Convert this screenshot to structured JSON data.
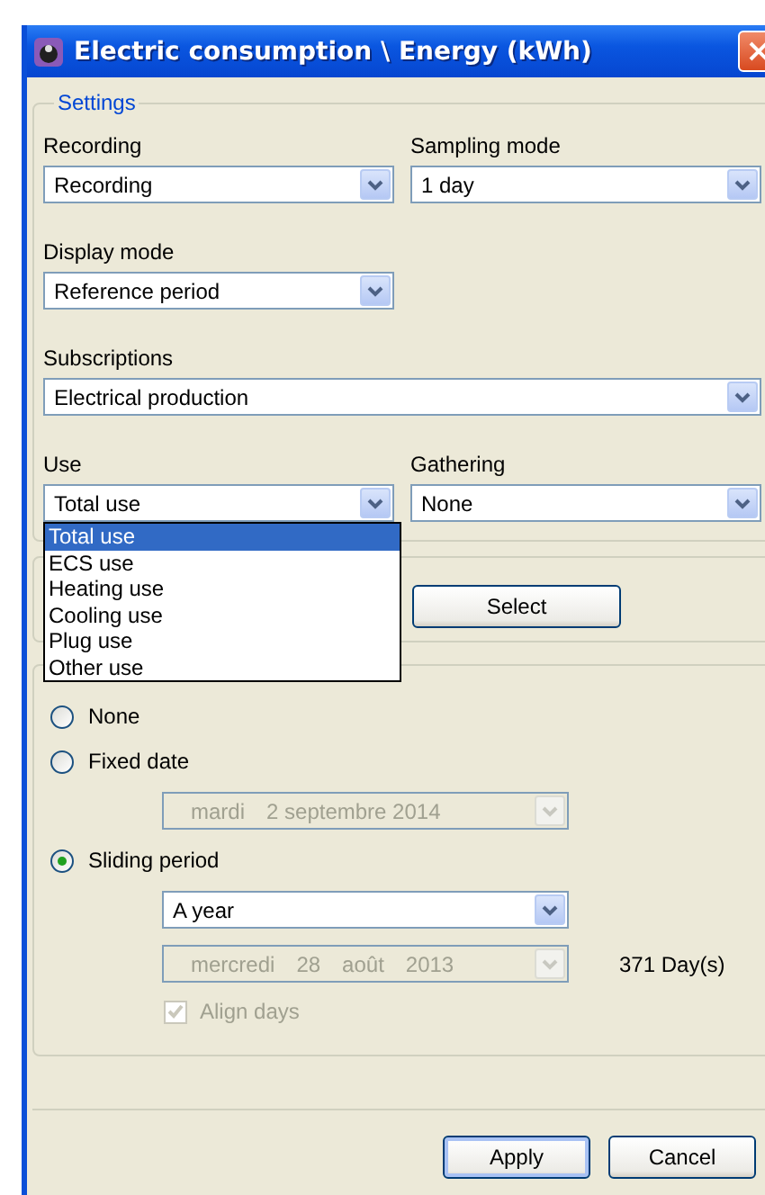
{
  "window": {
    "title": "Electric consumption \\ Energy (kWh)"
  },
  "settings": {
    "legend": "Settings",
    "rows": [
      [
        {
          "label": "Recording",
          "value": "Recording",
          "wide": false
        },
        {
          "label": "Sampling mode",
          "value": "1 day",
          "wide": false
        }
      ],
      [
        {
          "label": "Display mode",
          "value": "Reference period",
          "wide": false
        }
      ],
      [
        {
          "label": "Subscriptions",
          "value": "Electrical production",
          "wide": true
        }
      ],
      [
        {
          "label": "Use",
          "value": "Total use",
          "wide": false,
          "expanded": true,
          "options": [
            {
              "label": "Total use",
              "selected": true
            },
            {
              "label": "ECS use",
              "selected": false
            },
            {
              "label": "Heating use",
              "selected": false
            },
            {
              "label": "Cooling use",
              "selected": false
            },
            {
              "label": "Plug use",
              "selected": false
            },
            {
              "label": "Other use",
              "selected": false
            }
          ]
        },
        {
          "label": "Gathering",
          "value": "None",
          "wide": false
        }
      ]
    ]
  },
  "selection": {
    "button": "Select"
  },
  "period": {
    "options": [
      {
        "label": "None",
        "selected": false
      },
      {
        "label": "Fixed date",
        "selected": false,
        "date": {
          "parts": [
            "mardi",
            "2 septembre 2014"
          ],
          "disabled": true
        }
      },
      {
        "label": "Sliding period",
        "selected": true,
        "period": "A year",
        "date": {
          "parts": [
            "mercredi",
            "28",
            "août",
            "2013"
          ],
          "disabled": true
        },
        "duration": "371 Day(s)",
        "align_days": {
          "label": "Align days",
          "checked": true,
          "disabled": true
        }
      }
    ]
  },
  "buttons": [
    {
      "label": "Apply",
      "default": true
    },
    {
      "label": "Cancel",
      "default": false
    }
  ]
}
